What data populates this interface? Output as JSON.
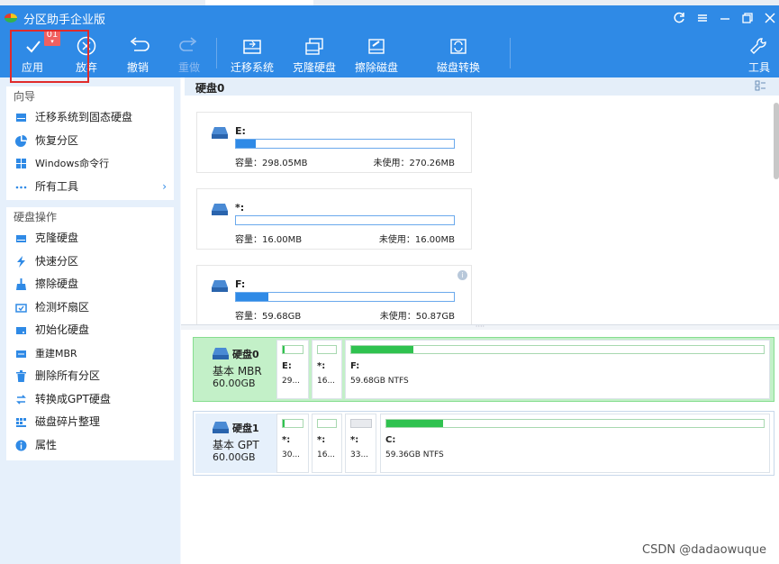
{
  "window": {
    "title": "分区助手企业版",
    "controls": [
      "refresh-icon",
      "feedback-icon",
      "menu-icon",
      "restore-icon",
      "close-icon"
    ]
  },
  "toolbar": {
    "apply": {
      "label": "应用",
      "icon": "check-icon",
      "badge": "01"
    },
    "discard": {
      "label": "放弃",
      "icon": "circle-x-icon"
    },
    "undo": {
      "label": "撤销",
      "icon": "undo-icon"
    },
    "redo": {
      "label": "重做",
      "icon": "redo-icon"
    },
    "migrate": {
      "label": "迁移系统",
      "icon": "migrate-os-icon"
    },
    "clone": {
      "label": "克隆硬盘",
      "icon": "clone-disk-icon"
    },
    "wipe": {
      "label": "擦除磁盘",
      "icon": "wipe-disk-icon"
    },
    "convert": {
      "label": "磁盘转换",
      "icon": "disk-convert-icon"
    },
    "tools": {
      "label": "工具",
      "icon": "wrench-icon"
    }
  },
  "sidebar": {
    "wizard": {
      "title": "向导",
      "items": [
        {
          "label": "迁移系统到固态硬盘",
          "icon": "migrate-icon"
        },
        {
          "label": "恢复分区",
          "icon": "pie-icon"
        },
        {
          "label": "Windows命令行",
          "icon": "windows-icon"
        },
        {
          "label": "所有工具",
          "icon": "more-icon"
        }
      ]
    },
    "disk_ops": {
      "title": "硬盘操作",
      "items": [
        {
          "label": "克隆硬盘",
          "icon": "clone-icon"
        },
        {
          "label": "快速分区",
          "icon": "lightning-icon"
        },
        {
          "label": "擦除硬盘",
          "icon": "broom-icon"
        },
        {
          "label": "检测坏扇区",
          "icon": "scan-icon"
        },
        {
          "label": "初始化硬盘",
          "icon": "init-disk-icon"
        },
        {
          "label": "重建MBR",
          "icon": "rebuild-mbr-icon"
        },
        {
          "label": "删除所有分区",
          "icon": "trash-icon"
        },
        {
          "label": "转换成GPT硬盘",
          "icon": "convert-icon"
        },
        {
          "label": "磁盘碎片整理",
          "icon": "defrag-icon"
        },
        {
          "label": "属性",
          "icon": "info-icon"
        }
      ]
    }
  },
  "main": {
    "header": "硬盘0",
    "partitions": [
      {
        "name": "E:",
        "capacity": "容量：298.05MB",
        "free": "未使用：270.26MB",
        "used": 0.09
      },
      {
        "name": "*:",
        "capacity": "容量：16.00MB",
        "free": "未使用：16.00MB",
        "used": 0.0
      },
      {
        "name": "F:",
        "capacity": "容量：59.68GB",
        "free": "未使用：50.87GB",
        "used": 0.15
      }
    ]
  },
  "disks": [
    {
      "name": "硬盘0",
      "type": "基本 MBR",
      "size": "60.00GB",
      "selected": true,
      "parts": [
        {
          "label": "E:",
          "size": "29...",
          "used": 0.1
        },
        {
          "label": "*:",
          "size": "16...",
          "used": 0.0
        },
        {
          "label": "F:",
          "size": "59.68GB NTFS",
          "used": 0.15
        }
      ]
    },
    {
      "name": "硬盘1",
      "type": "基本 GPT",
      "size": "60.00GB",
      "selected": false,
      "parts": [
        {
          "label": "*:",
          "size": "30...",
          "used": 0.1
        },
        {
          "label": "*:",
          "size": "16...",
          "used": 0.0
        },
        {
          "label": "*:",
          "size": "33...",
          "used": 0.0
        },
        {
          "label": "C:",
          "size": "59.36GB NTFS",
          "used": 0.15
        }
      ]
    }
  ],
  "watermark": "CSDN @dadaowuque",
  "colors": {
    "accent": "#2f8ae6",
    "used_green": "#2fc24f",
    "selected_disk": "#c3f0c8",
    "highlight_box": "#e02b2b"
  }
}
